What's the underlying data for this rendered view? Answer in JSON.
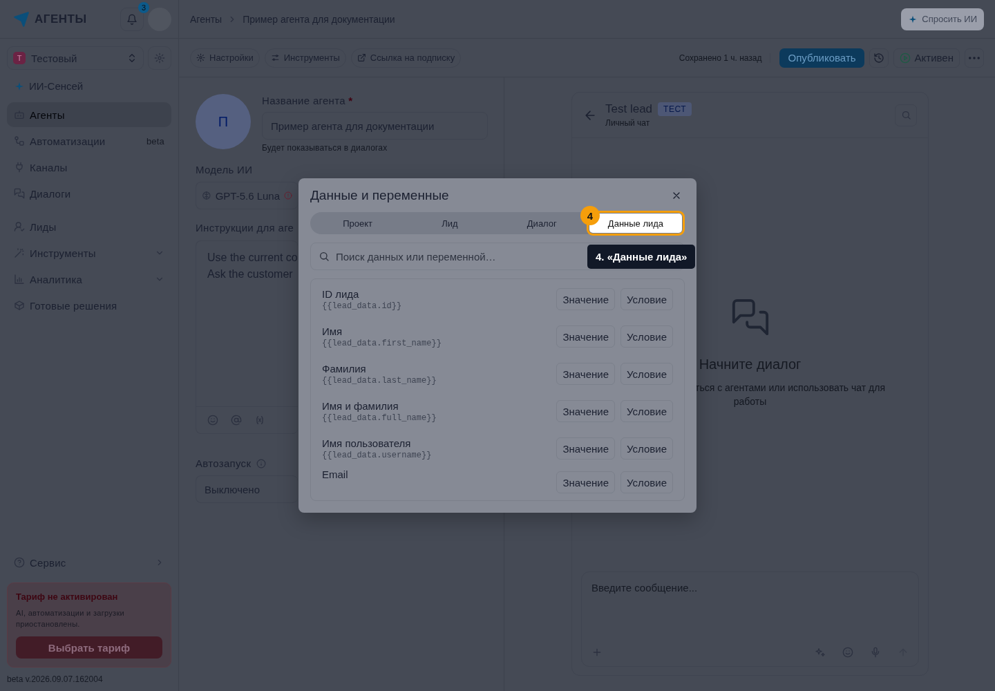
{
  "app": {
    "logo": "АГЕНТЫ",
    "notifications": "3"
  },
  "breadcrumbs": [
    {
      "label": "Агенты"
    },
    {
      "label": "Пример агента для документации"
    }
  ],
  "ask_ai": "Спросить ИИ",
  "workspace": {
    "initial": "Т",
    "name": "Тестовый"
  },
  "sidebar": {
    "sensei": "ИИ-Сенсей",
    "groups": [
      {
        "items": [
          {
            "label": "Агенты",
            "selected": true
          },
          {
            "label": "Автоматизации",
            "selected": false,
            "badge": "beta"
          },
          {
            "label": "Каналы",
            "selected": false
          },
          {
            "label": "Диалоги",
            "selected": false
          }
        ]
      },
      {
        "items": [
          {
            "label": "Лиды",
            "selected": false
          },
          {
            "label": "Инструменты",
            "selected": false,
            "expanded": false
          },
          {
            "label": "Аналитика",
            "selected": false,
            "expanded": false
          },
          {
            "label": "Готовые решения",
            "selected": false
          }
        ]
      }
    ],
    "service": "Сервис"
  },
  "plan_notice": {
    "title": "Тариф не активирован",
    "text": "AI, автоматизации и загрузки приостановлены.",
    "button": "Выбрать тариф"
  },
  "version": "beta v.2026.09.07.162004",
  "toolbar": {
    "tabs": [
      {
        "label": "Настройки"
      },
      {
        "label": "Инструменты"
      },
      {
        "label": "Ссылка на подписку"
      }
    ],
    "saved": "Сохранено 1 ч. назад",
    "publish": "Опубликовать",
    "status": "Активен"
  },
  "agent_form": {
    "avatar": "П",
    "name_label": "Название агента",
    "required_mark": "*",
    "name_value": "Пример агента для документации",
    "name_hint": "Будет показываться в диалогах",
    "model_label": "Модель ИИ",
    "model_value": "GPT-5.6 Luna",
    "instructions_label": "Инструкции для аге",
    "instructions_lines": [
      "Use the current co",
      "Ask the customer"
    ],
    "autostart_label": "Автозапуск",
    "autostart_value": "Выключено"
  },
  "chat": {
    "title": "Test lead",
    "tag": "ТЕСТ",
    "subtitle": "Личный чат",
    "empty_title": "Начните диалог",
    "empty_lines": [
      "ться с агентами или использовать чат для",
      "работы"
    ],
    "placeholder": "Введите сообщение..."
  },
  "modal": {
    "title": "Данные и переменные",
    "tabs": [
      {
        "label": "Проект",
        "selected": false
      },
      {
        "label": "Лид",
        "selected": false
      },
      {
        "label": "Диалог",
        "selected": false
      },
      {
        "label": "Данные лида",
        "selected": true
      }
    ],
    "search_placeholder": "Поиск данных или переменной…",
    "rows": [
      {
        "label": "ID лида",
        "variable": "{{lead_data.id}}",
        "actions": [
          "Значение",
          "Условие"
        ]
      },
      {
        "label": "Имя",
        "variable": "{{lead_data.first_name}}",
        "actions": [
          "Значение",
          "Условие"
        ]
      },
      {
        "label": "Фамилия",
        "variable": "{{lead_data.last_name}}",
        "actions": [
          "Значение",
          "Условие"
        ]
      },
      {
        "label": "Имя и фамилия",
        "variable": "{{lead_data.full_name}}",
        "actions": [
          "Значение",
          "Условие"
        ]
      },
      {
        "label": "Имя пользователя",
        "variable": "{{lead_data.username}}",
        "actions": [
          "Значение",
          "Условие"
        ]
      },
      {
        "label": "Email",
        "actions": [
          "Значение",
          "Условие"
        ]
      }
    ]
  },
  "tour": {
    "step": "4",
    "tooltip": "4. «Данные лида»"
  }
}
